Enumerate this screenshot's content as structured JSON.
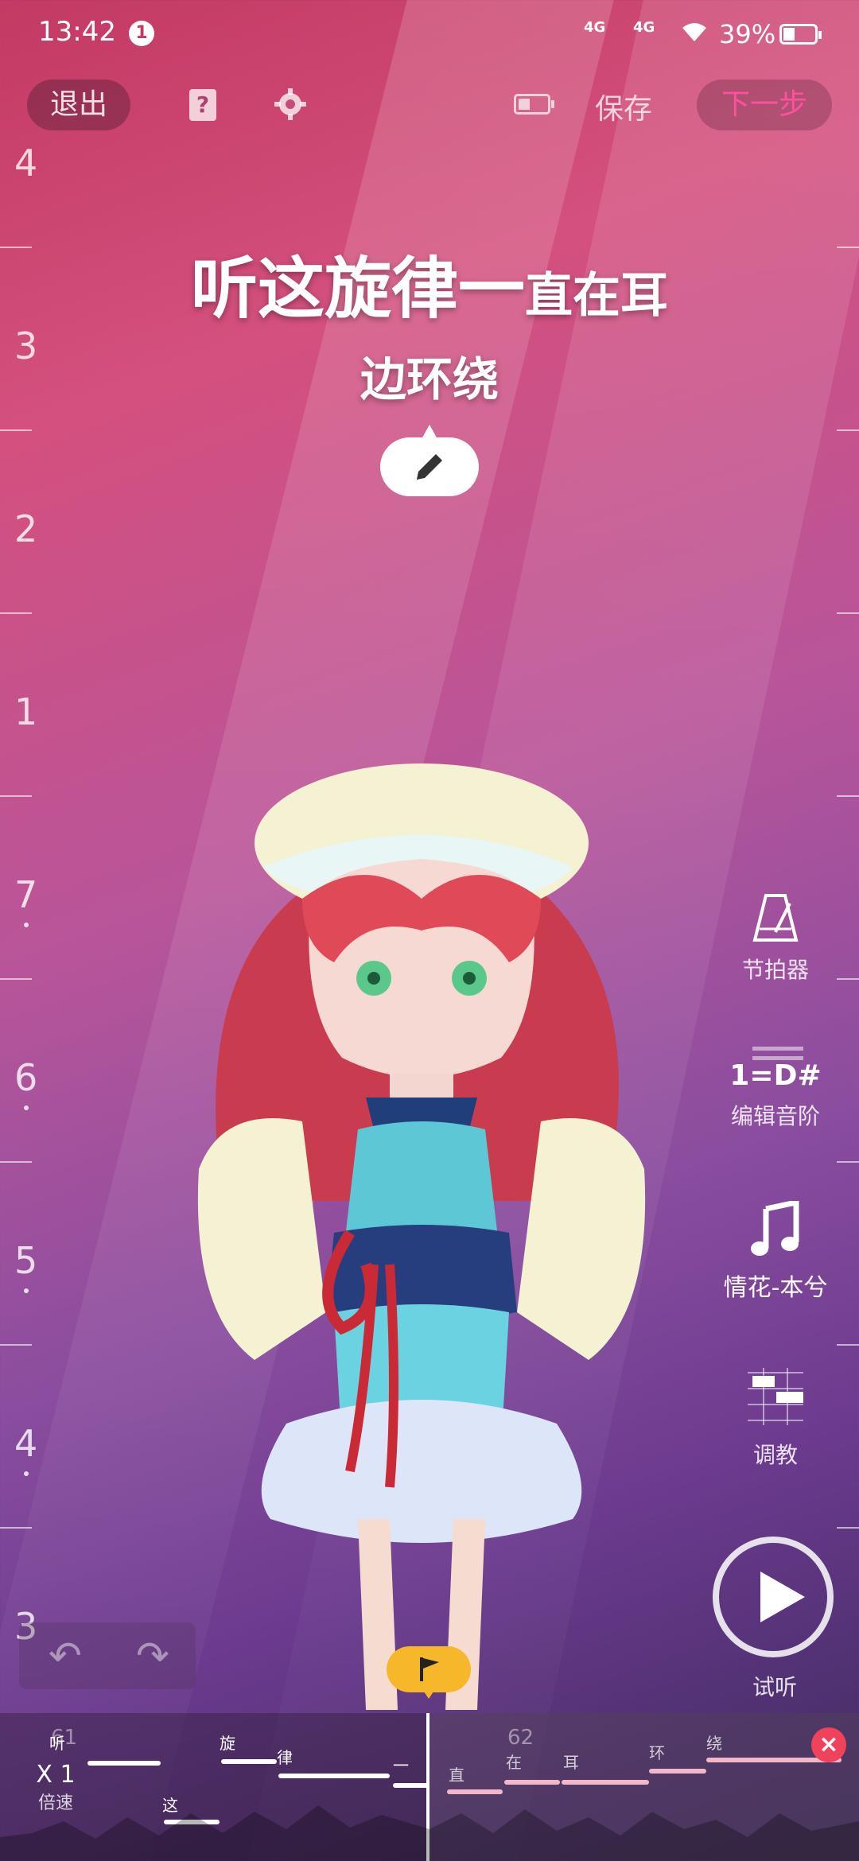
{
  "status_bar": {
    "time": "13:42",
    "notification_count": "1",
    "signal1": "4G",
    "signal2": "4G",
    "battery": "39%"
  },
  "toolbar": {
    "exit_label": "退出",
    "help_glyph": "?",
    "save_label": "保存",
    "next_label": "下一步",
    "next_color": "#ff4fa0"
  },
  "ruler": {
    "labels": [
      "4",
      "3",
      "2",
      "1",
      "7",
      "6",
      "5",
      "4",
      "3"
    ]
  },
  "lyrics": {
    "line1_big": "听这旋律一",
    "line1_small": "直在耳",
    "line2": "边环绕"
  },
  "tools": {
    "metronome_label": "节拍器",
    "scale_value": "1=D#",
    "scale_label": "编辑音阶",
    "song_label": "情花-本兮",
    "tune_label": "调教",
    "play_label": "试听"
  },
  "timeline": {
    "speed_value": "X 1",
    "speed_label": "倍速",
    "marker_left": "61",
    "marker_right": "62",
    "words": [
      "听",
      "这",
      "旋",
      "律",
      "一",
      "直",
      "在",
      "耳",
      "环",
      "绕"
    ]
  },
  "icons": {
    "help": "help-book-icon",
    "settings": "gear-icon",
    "battery_mode": "battery-icon",
    "edit": "pencil-icon",
    "metronome": "metronome-icon",
    "scale": "scale-icon",
    "song": "music-note-icon",
    "tune": "piano-roll-icon",
    "play": "play-icon",
    "undo": "undo-icon",
    "redo": "redo-icon",
    "flag": "flag-icon",
    "close": "close-icon"
  }
}
